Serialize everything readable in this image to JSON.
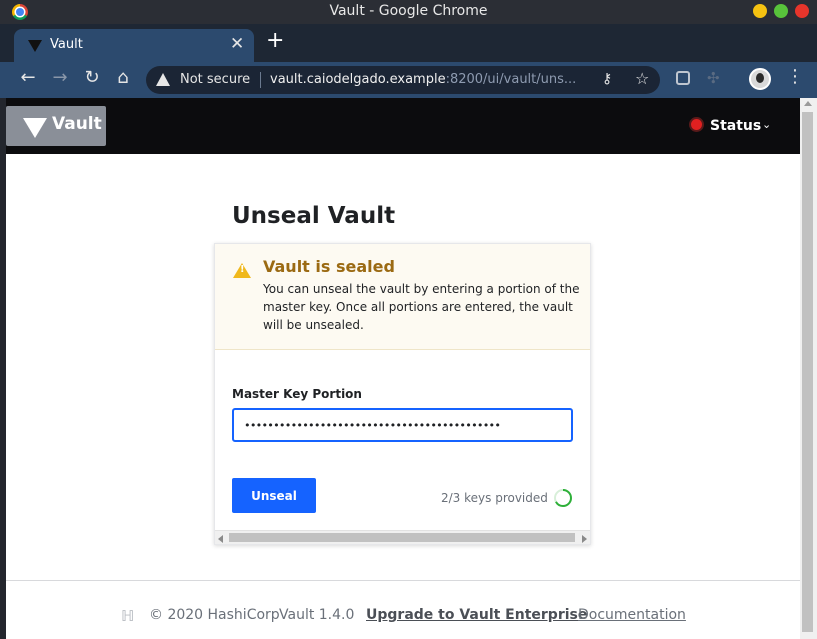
{
  "window": {
    "title": "Vault - Google Chrome"
  },
  "tab": {
    "title": "Vault",
    "close": "✕",
    "new_tab": "+"
  },
  "toolbar": {
    "back": "←",
    "forward": "→",
    "reload": "↻",
    "home": "⌂",
    "security_label": "Not secure",
    "url_host": "vault.caiodelgado.example",
    "url_rest": ":8200/ui/vault/uns...",
    "menu": "⋮"
  },
  "vault_nav": {
    "logo_text": "Vault",
    "status_label": "Status",
    "status_color": "#e02020"
  },
  "main": {
    "title": "Unseal Vault",
    "alert": {
      "title": "Vault is sealed",
      "body": "You can unseal the vault by entering a portion of the master key. Once all portions are entered, the vault will be unsealed.",
      "color": "#9b6a13"
    },
    "field_label": "Master Key Portion",
    "input_value": "••••••••••••••••••••••••••••••••••••••••••••",
    "unseal_button": "Unseal",
    "keys_provided": "2/3 keys provided",
    "keys_progress": 0.6667,
    "accent_color": "#1563ff"
  },
  "footer": {
    "copyright": "© 2020 HashiCorp",
    "version": "Vault 1.4.0",
    "upgrade_link": "Upgrade to Vault Enterprise",
    "docs_link": "Documentation"
  }
}
